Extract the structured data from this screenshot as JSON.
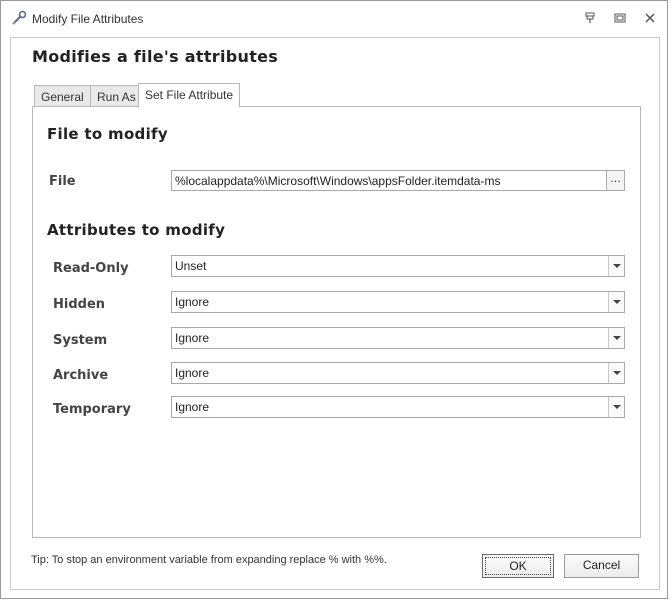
{
  "window": {
    "title": "Modify File Attributes"
  },
  "dialog": {
    "heading": "Modifies a file's attributes"
  },
  "tabs": [
    {
      "label": "General",
      "active": false
    },
    {
      "label": "Run As",
      "active": false
    },
    {
      "label": "Set File Attribute",
      "active": true
    }
  ],
  "file_section": {
    "title": "File to modify",
    "file_label": "File",
    "file_value": "%localappdata%\\Microsoft\\Windows\\appsFolder.itemdata-ms",
    "browse_label": "..."
  },
  "attributes_section": {
    "title": "Attributes to modify",
    "items": [
      {
        "label": "Read-Only",
        "value": "Unset"
      },
      {
        "label": "Hidden",
        "value": "Ignore"
      },
      {
        "label": "System",
        "value": "Ignore"
      },
      {
        "label": "Archive",
        "value": "Ignore"
      },
      {
        "label": "Temporary",
        "value": "Ignore"
      }
    ]
  },
  "footer": {
    "tip": "Tip: To stop an environment variable from expanding replace % with %%.",
    "ok_label": "OK",
    "cancel_label": "Cancel"
  },
  "icons": {
    "app": "wrench-key-icon",
    "pin": "pin-icon",
    "restore": "restore-icon",
    "close": "close-icon",
    "dropdown": "chevron-down-icon"
  }
}
